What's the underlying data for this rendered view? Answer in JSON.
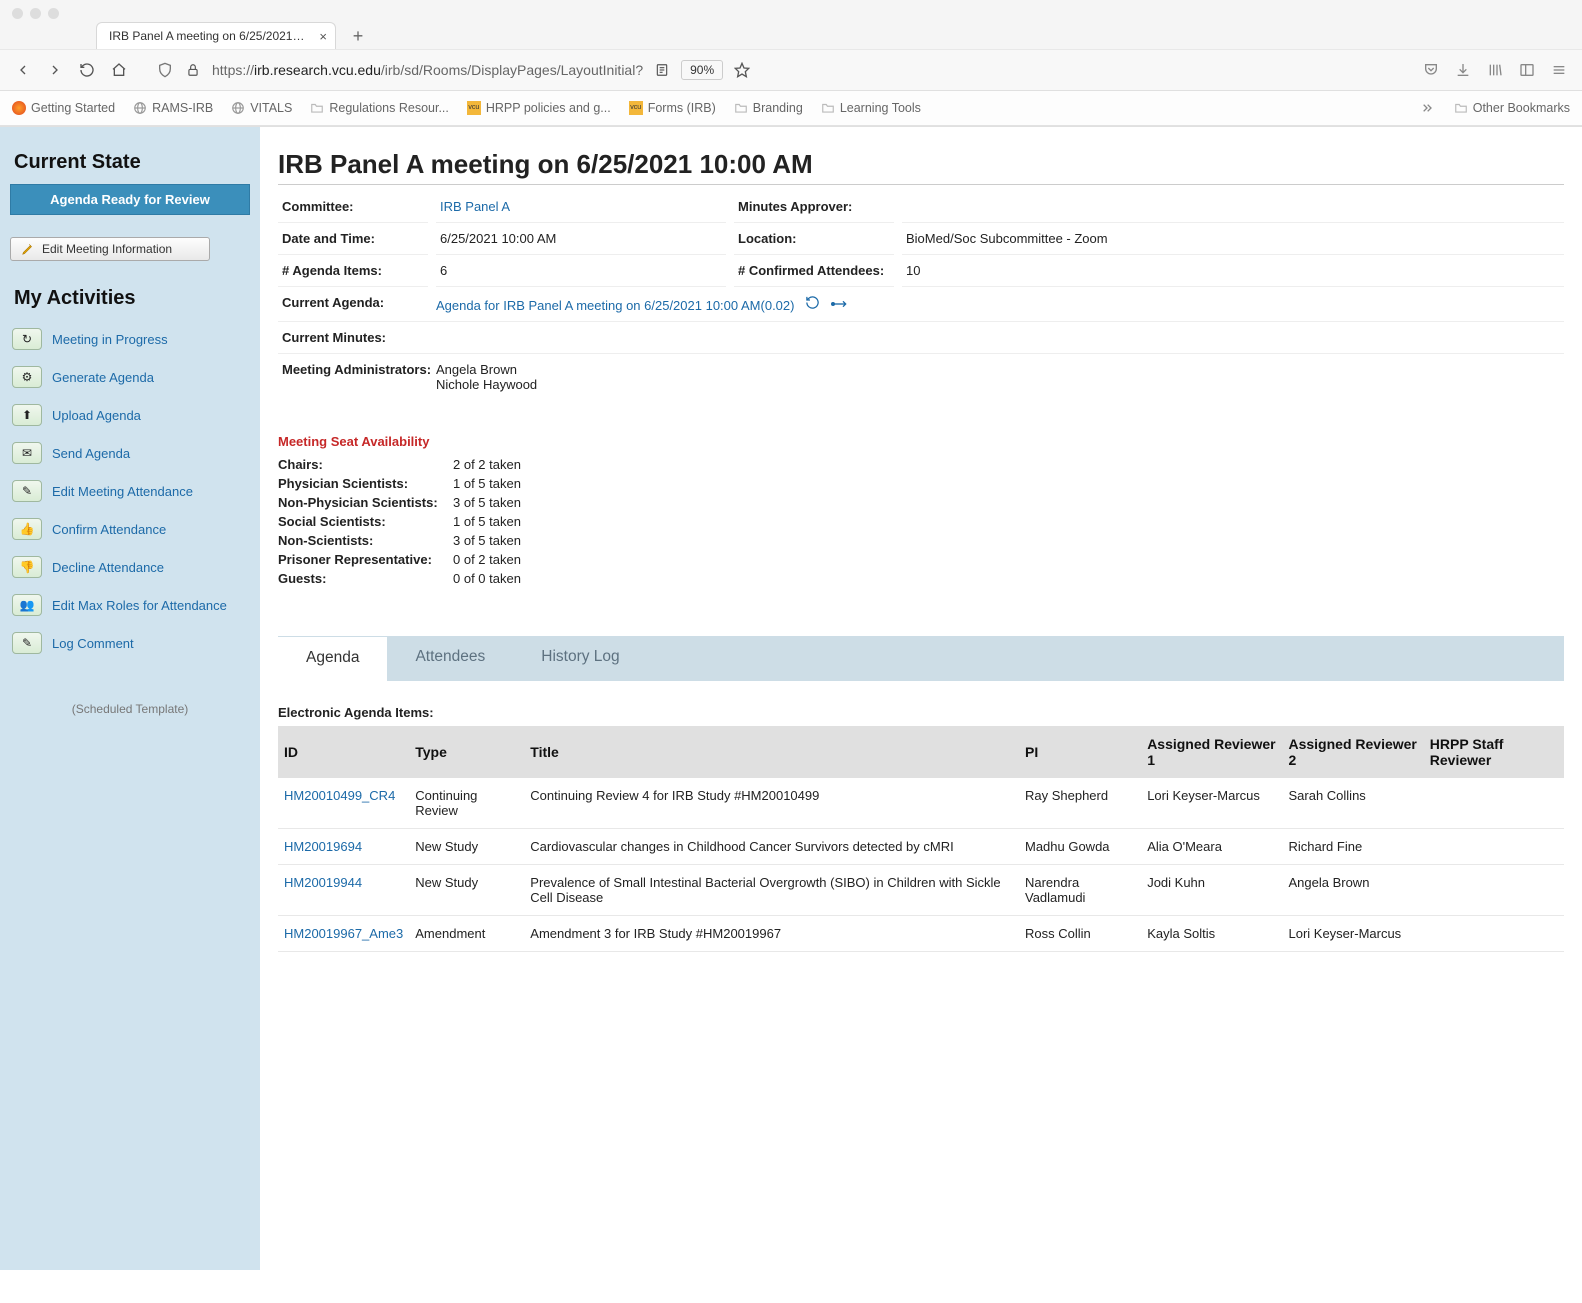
{
  "browser": {
    "tab_title": "IRB Panel A meeting on 6/25/2021 1…",
    "url_prefix": "https://",
    "url_host": "irb.research.vcu.edu",
    "url_path": "/irb/sd/Rooms/DisplayPages/LayoutInitial?",
    "zoom": "90%"
  },
  "bookmarks": [
    "Getting Started",
    "RAMS-IRB",
    "VITALS",
    "Regulations Resour...",
    "HRPP policies and g...",
    "Forms (IRB)",
    "Branding",
    "Learning Tools"
  ],
  "other_bookmarks_label": "Other Bookmarks",
  "sidebar": {
    "state_heading": "Current State",
    "state_value": "Agenda Ready for Review",
    "edit_meeting_label": "Edit Meeting Information",
    "activities_heading": "My Activities",
    "sched_template": "(Scheduled Template)",
    "activities": [
      "Meeting in Progress",
      "Generate Agenda",
      "Upload Agenda",
      "Send Agenda",
      "Edit Meeting Attendance",
      "Confirm Attendance",
      "Decline Attendance",
      "Edit Max Roles for Attendance",
      "Log Comment"
    ]
  },
  "header": {
    "title": "IRB Panel A meeting on 6/25/2021 10:00 AM",
    "labels": {
      "committee": "Committee:",
      "minutes_approver": "Minutes Approver:",
      "date_time": "Date and Time:",
      "location": "Location:",
      "agenda_items": "# Agenda Items:",
      "confirmed_attendees": "# Confirmed Attendees:",
      "current_agenda": "Current Agenda:",
      "current_minutes": "Current Minutes:",
      "meeting_admins": "Meeting Administrators:"
    },
    "committee": "IRB Panel A",
    "minutes_approver": "",
    "date_time": "6/25/2021 10:00 AM",
    "location": "BioMed/Soc Subcommittee - Zoom",
    "agenda_items": "6",
    "confirmed_attendees": "10",
    "current_agenda": "Agenda for IRB Panel A meeting on 6/25/2021 10:00 AM(0.02)",
    "current_minutes": "",
    "meeting_admins": "Angela Brown\nNichole Haywood"
  },
  "seats": {
    "title": "Meeting Seat Availability",
    "rows": [
      {
        "label": "Chairs:",
        "value": "2 of 2 taken"
      },
      {
        "label": "Physician Scientists:",
        "value": "1 of 5 taken"
      },
      {
        "label": "Non-Physician Scientists:",
        "value": "3 of 5 taken"
      },
      {
        "label": "Social Scientists:",
        "value": "1 of 5 taken"
      },
      {
        "label": "Non-Scientists:",
        "value": "3 of 5 taken"
      },
      {
        "label": "Prisoner Representative:",
        "value": "0 of 2 taken"
      },
      {
        "label": "Guests:",
        "value": "0 of 0 taken"
      }
    ]
  },
  "tabs": {
    "agenda": "Agenda",
    "attendees": "Attendees",
    "history": "History Log"
  },
  "agenda": {
    "section_label": "Electronic Agenda Items:",
    "columns": {
      "id": "ID",
      "type": "Type",
      "title": "Title",
      "pi": "PI",
      "rev1": "Assigned Reviewer 1",
      "rev2": "Assigned Reviewer 2",
      "staff": "HRPP Staff Reviewer"
    },
    "rows": [
      {
        "id": "HM20010499_CR4",
        "type": "Continuing Review",
        "title": "Continuing Review 4 for IRB Study #HM20010499",
        "pi": "Ray Shepherd",
        "rev1": "Lori Keyser-Marcus",
        "rev2": "Sarah Collins",
        "staff": ""
      },
      {
        "id": "HM20019694",
        "type": "New Study",
        "title": "Cardiovascular changes in Childhood Cancer Survivors detected by cMRI",
        "pi": "Madhu Gowda",
        "rev1": "Alia O'Meara",
        "rev2": "Richard Fine",
        "staff": ""
      },
      {
        "id": "HM20019944",
        "type": "New Study",
        "title": "Prevalence of Small Intestinal Bacterial Overgrowth (SIBO) in Children with Sickle Cell Disease",
        "pi": "Narendra Vadlamudi",
        "rev1": "Jodi Kuhn",
        "rev2": "Angela Brown",
        "staff": ""
      },
      {
        "id": "HM20019967_Ame3",
        "type": "Amendment",
        "title": "Amendment 3 for IRB Study #HM20019967",
        "pi": "Ross Collin",
        "rev1": "Kayla Soltis",
        "rev2": "Lori Keyser-Marcus",
        "staff": ""
      }
    ]
  }
}
